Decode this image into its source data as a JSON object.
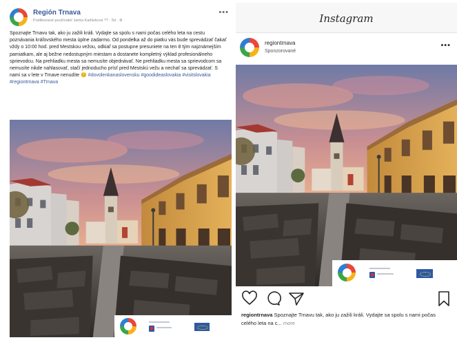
{
  "facebook": {
    "page_name": "Región Trnava",
    "meta_text": "Publikované používateľ Janka Kaďárková ?? · 5d · ⚙",
    "post_text": "Spoznajte Trnavu tak, ako ju zažili králi. Vydajte sa spolu s nami počas celého leta na cestu poznávania kráľovského mesta úplne zadarmo. Od pondelka až do piatku vás bude sprevádzať čakať vždy o 10:00 hod. pred Mestskou vežou, odkiaľ sa postupne presuniete na ten 8 tým najznámejším pamiatkam, ale aj bežne nedostupným miestam a dostanete kompletný výklad profesionálneho sprievodcu. Na prehliadku mesta sa nemusíte objednávať. Ne prehliadku mesta sa sprievodcom sa nemusíte nikde nahlasovať, stačí jednoducho prísť pred Mestskú vežu a nechať sa sprevádzať. S nami sa v lete v Trnave nenudíte 😊",
    "hashtags": "#dovolenkanaslovensku #goodideaslovakia #visitslovakia #regiontrnava #Trnava"
  },
  "instagram": {
    "brand": "Instagram",
    "username": "regiontrnava",
    "sponsored": "Sponzorované",
    "caption_user": "regiontrnava",
    "caption_text": " Spoznajte Trnavu tak, ako ju zažili králi. Vydajte sa spolu s nami počas celého leta na c...",
    "more_label": "more"
  },
  "icons": {
    "like": "heart-icon",
    "comment": "comment-icon",
    "share": "send-icon",
    "save": "bookmark-icon",
    "menu": "more-dots-icon"
  },
  "colors": {
    "facebook_link": "#385898",
    "instagram_text": "#262626",
    "sky_top": "#7d86ad",
    "sky_pink": "#e49a86",
    "facade_yellow": "#d8a24a"
  }
}
